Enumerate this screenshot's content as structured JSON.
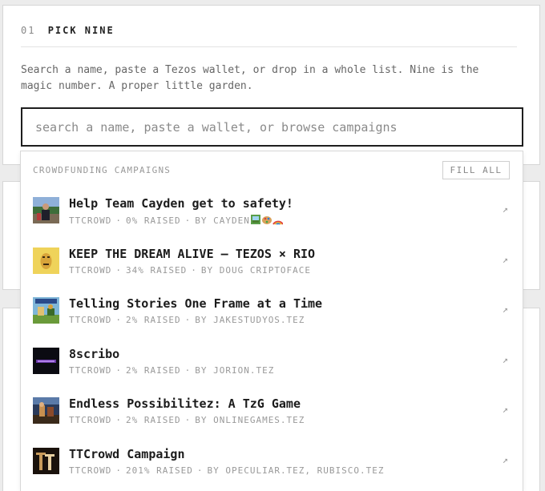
{
  "section": {
    "number": "01",
    "title": "PICK NINE",
    "intro": "Search a name, paste a Tezos wallet, or drop in a whole list. Nine is the magic number. A proper little garden."
  },
  "search": {
    "placeholder": "search a name, paste a wallet, or browse campaigns",
    "value": ""
  },
  "dropdown": {
    "heading": "CROWDFUNDING CAMPAIGNS",
    "fill_all_label": "FILL ALL",
    "meta_separator": "·",
    "arrow_glyph": "↗",
    "items": [
      {
        "title": "Help Team Cayden get to safety!",
        "source": "TTCROWD",
        "raised": "0% RAISED",
        "by": "BY CAYDEN",
        "icon": "cayden-campaign-thumb"
      },
      {
        "title": "KEEP THE DREAM ALIVE — TEZOS × RIO",
        "source": "TTCROWD",
        "raised": "34% RAISED",
        "by": "BY DOUG CRIPTOFACE",
        "icon": "dream-alive-campaign-thumb"
      },
      {
        "title": "Telling Stories One Frame at a Time",
        "source": "TTCROWD",
        "raised": "2% RAISED",
        "by": "BY JAKESTUDYOS.TEZ",
        "icon": "telling-stories-campaign-thumb"
      },
      {
        "title": "8scribo",
        "source": "TTCROWD",
        "raised": "2% RAISED",
        "by": "BY JORION.TEZ",
        "icon": "8scribo-campaign-thumb"
      },
      {
        "title": "Endless Possibilitez: A TzG Game",
        "source": "TTCROWD",
        "raised": "2% RAISED",
        "by": "BY ONLINEGAMES.TEZ",
        "icon": "endless-possibilitez-campaign-thumb"
      },
      {
        "title": "TTCrowd Campaign",
        "source": "TTCROWD",
        "raised": "201% RAISED",
        "by": "BY OPECULIAR.TEZ, RUBISCO.TEZ",
        "icon": "ttcrowd-campaign-thumb"
      }
    ]
  },
  "colors": {
    "page_bg": "#ececec",
    "card_bg": "#ffffff",
    "search_border": "#1e1e1e",
    "muted_text": "#999999"
  }
}
